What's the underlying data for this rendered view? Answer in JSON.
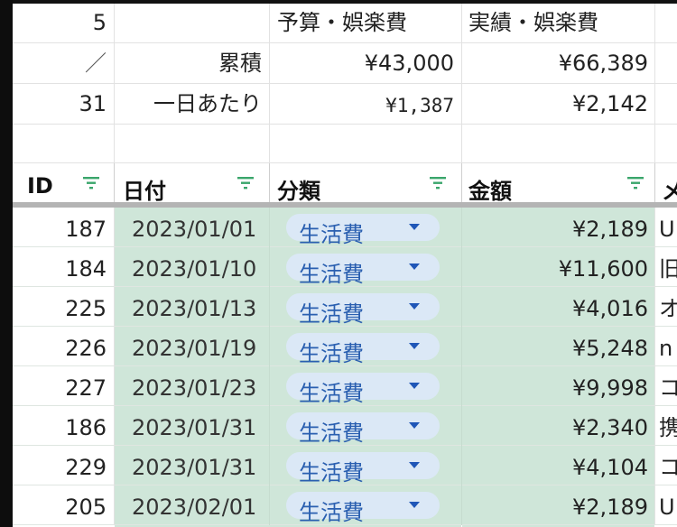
{
  "summary": {
    "r1": {
      "a": "5",
      "b": "",
      "c": "予算・娯楽費",
      "d": "実績・娯楽費"
    },
    "r2": {
      "a": "／",
      "b": "累積",
      "c": "¥43,000",
      "d": "¥66,389"
    },
    "r3": {
      "a": "31",
      "b": "一日あたり",
      "c": "¥1,387",
      "d": "¥2,142"
    }
  },
  "table": {
    "headers": {
      "id": "ID",
      "date": "日付",
      "category": "分類",
      "amount": "金額",
      "memo": "メ"
    },
    "rows": [
      {
        "id": "187",
        "date": "2023/01/01",
        "category": "生活費",
        "amount": "¥2,189",
        "memo": "U"
      },
      {
        "id": "184",
        "date": "2023/01/10",
        "category": "生活費",
        "amount": "¥11,600",
        "memo": "旧"
      },
      {
        "id": "225",
        "date": "2023/01/13",
        "category": "生活費",
        "amount": "¥4,016",
        "memo": "オ"
      },
      {
        "id": "226",
        "date": "2023/01/19",
        "category": "生活費",
        "amount": "¥5,248",
        "memo": "n"
      },
      {
        "id": "227",
        "date": "2023/01/23",
        "category": "生活費",
        "amount": "¥9,998",
        "memo": "コ"
      },
      {
        "id": "186",
        "date": "2023/01/31",
        "category": "生活費",
        "amount": "¥2,340",
        "memo": "携"
      },
      {
        "id": "229",
        "date": "2023/01/31",
        "category": "生活費",
        "amount": "¥4,104",
        "memo": "コ"
      },
      {
        "id": "205",
        "date": "2023/02/01",
        "category": "生活費",
        "amount": "¥2,189",
        "memo": "U"
      }
    ]
  },
  "colors": {
    "selection_green": "#cfe6d9",
    "chip_bg": "#dbe8f6",
    "chip_text": "#2a5fb0",
    "filter_icon": "#3aa66b"
  },
  "icons": {
    "filter": "filter-icon",
    "dropdown": "dropdown-arrow-icon"
  }
}
